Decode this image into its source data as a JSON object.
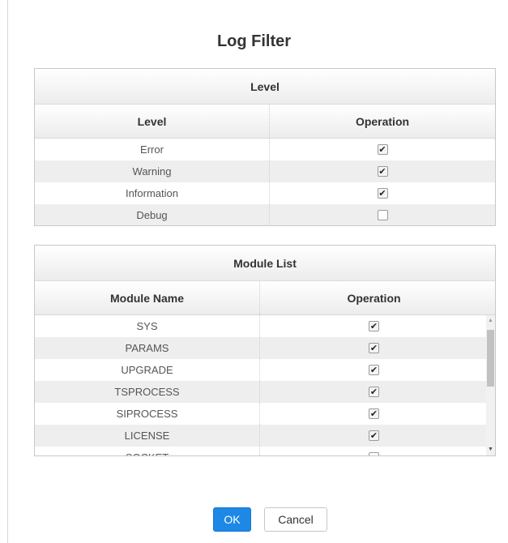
{
  "dialog": {
    "title": "Log Filter"
  },
  "level_panel": {
    "header": "Level",
    "columns": [
      "Level",
      "Operation"
    ],
    "rows": [
      {
        "name": "Error",
        "checked": true
      },
      {
        "name": "Warning",
        "checked": true
      },
      {
        "name": "Information",
        "checked": true
      },
      {
        "name": "Debug",
        "checked": false
      }
    ]
  },
  "module_panel": {
    "header": "Module List",
    "columns": [
      "Module Name",
      "Operation"
    ],
    "rows": [
      {
        "name": "SYS",
        "checked": true
      },
      {
        "name": "PARAMS",
        "checked": true
      },
      {
        "name": "UPGRADE",
        "checked": true
      },
      {
        "name": "TSPROCESS",
        "checked": true
      },
      {
        "name": "SIPROCESS",
        "checked": true
      },
      {
        "name": "LICENSE",
        "checked": true
      },
      {
        "name": "SOCKET",
        "checked": false
      }
    ]
  },
  "buttons": {
    "ok": "OK",
    "cancel": "Cancel"
  },
  "colors": {
    "primary": "#1e88e5"
  },
  "icons": {
    "checkbox_checked": "check-mark-icon",
    "scroll_up": "triangle-up-icon",
    "scroll_down": "triangle-down-icon"
  }
}
